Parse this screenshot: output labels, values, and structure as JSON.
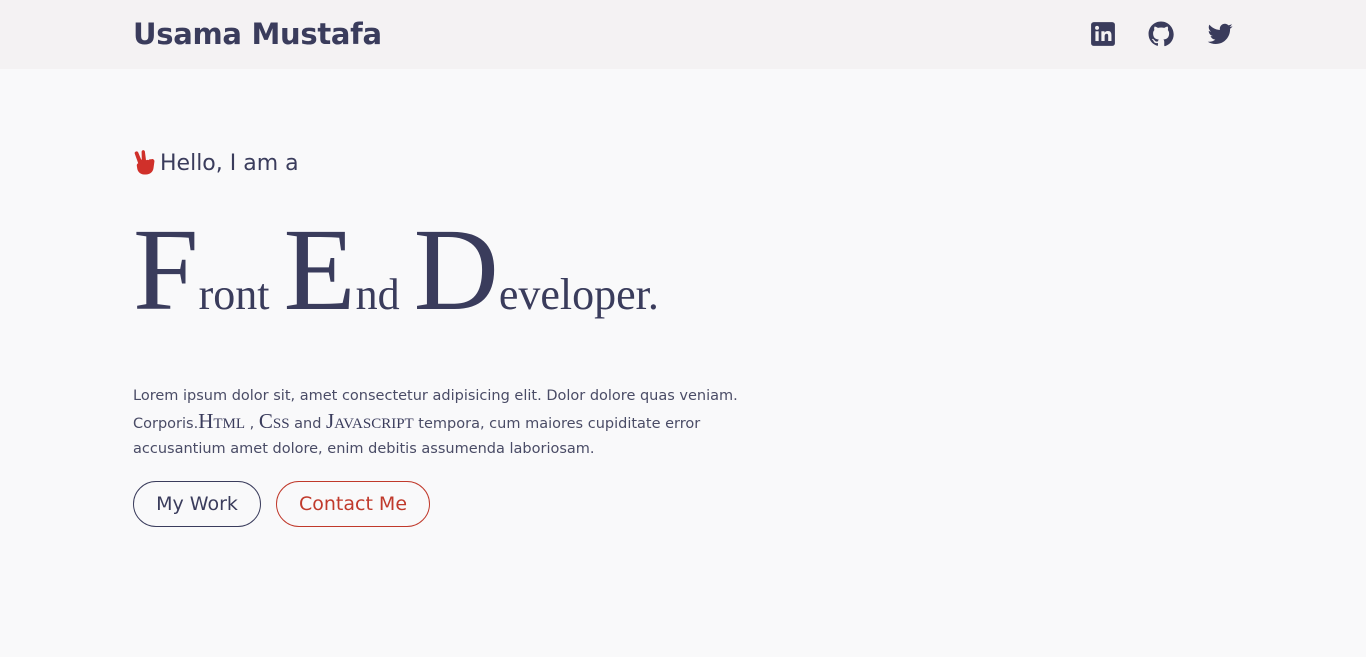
{
  "header": {
    "brand": "Usama Mustafa",
    "social": [
      {
        "icon": "linkedin-icon"
      },
      {
        "icon": "github-icon"
      },
      {
        "icon": "twitter-icon"
      }
    ]
  },
  "hero": {
    "greeting": "Hello, I am a",
    "greeting_icon": "victory-hand-icon",
    "headline": [
      {
        "cap": "F",
        "rest": "ront"
      },
      {
        "cap": "E",
        "rest": "nd"
      },
      {
        "cap": "D",
        "rest": "eveloper."
      }
    ],
    "description": {
      "line1": "Lorem ipsum dolor sit, amet consectetur adipisicing elit. Dolor dolore quas veniam.",
      "corporis": "Corporis.",
      "html": "Html",
      "sep": " , ",
      "css": "Css",
      "and": " and ",
      "js": "Javascript",
      "after": " tempora, cum maiores cupiditate error accusantium amet dolore, enim debitis assumenda laboriosam."
    },
    "buttons": {
      "work": "My Work",
      "contact": "Contact Me"
    }
  },
  "colors": {
    "primary": "#3a3c5c",
    "accent": "#c0392b",
    "nav_bg": "#f4f2f3",
    "page_bg": "#f9f9fa"
  }
}
